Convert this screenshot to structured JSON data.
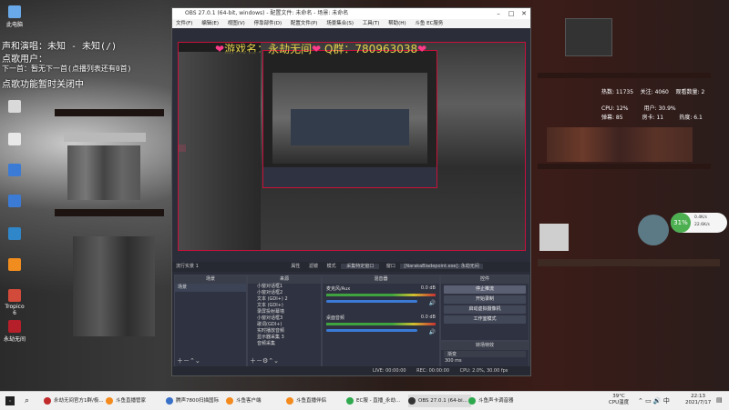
{
  "desktop": {
    "overlay_lines": [
      "声和演唱：未知 - 未知(/)",
      "点歌用户：",
      "下一首：暂无下一首(点播列表还有0首)",
      "点歌功能暂时关闭中"
    ],
    "icons": [
      {
        "label": "此电脑",
        "color": "#6aa9e9"
      },
      {
        "label": "",
        "color": "#d9d9d9"
      },
      {
        "label": "",
        "color": "#3b7bd6"
      },
      {
        "label": "",
        "color": "#e8e8e8"
      },
      {
        "label": "",
        "color": "#3b7bd6"
      },
      {
        "label": "",
        "color": "#3b7bd6"
      },
      {
        "label": "",
        "color": "#2f86c8"
      },
      {
        "label": "",
        "color": "#f08d1e"
      },
      {
        "label": "Tropico 6",
        "color": "#d24b3a"
      },
      {
        "label": "永劫无间",
        "color": "#b51f2a"
      }
    ]
  },
  "obs": {
    "title": "OBS 27.0.1 (64-bit, windows) - 配置文件: 未命名 - 场景: 未命名",
    "menu": [
      "文件(F)",
      "编辑(E)",
      "视图(V)",
      "停靠部件(D)",
      "配置文件(P)",
      "场景集合(S)",
      "工具(T)",
      "帮助(H)",
      "斗鱼 EC服务"
    ],
    "banner": {
      "game": "游戏名：永劫无间",
      "qq": "Q群：780963038"
    },
    "toolbar": {
      "source_label": "流行实景 1",
      "properties": "属性",
      "filters": "滤镜",
      "mode_label": "模式",
      "mode_value": "采集特定窗口",
      "window_label": "窗口",
      "window_value": "[NarakaBladepoint.exe]: 永劫无间"
    },
    "scenes": {
      "header": "场景",
      "items": [
        "场景"
      ]
    },
    "sources": {
      "header": "来源",
      "items": [
        "小窗对话框1",
        "小窗对话框2",
        "文本 (GDI+) 2",
        "文本 (GDI+)",
        "录屏投射幕墙",
        "小窗对话框3",
        "歌词(GDI+)",
        "实时播放音频",
        "显示器采集 3",
        "音频采集",
        "显示器采集"
      ]
    },
    "mixer": {
      "header": "混音器",
      "channels": [
        {
          "name": "麦克风/Aux",
          "db": "0.0 dB"
        },
        {
          "name": "桌面音频",
          "db": "0.0 dB"
        }
      ]
    },
    "transitions": {
      "header": "转场特效",
      "type": "渐变",
      "duration": "300 ms"
    },
    "controls": {
      "header": "控件",
      "buttons": [
        "停止推流",
        "开始录制",
        "启动虚拟摄像机",
        "工作室模式",
        "设置",
        "退出"
      ]
    },
    "status": {
      "live": "LIVE: 00:00:00",
      "rec": "REC: 00:00:00",
      "cpu": "CPU: 2.0%, 30.00 fps"
    }
  },
  "perf_overlay": {
    "lines": [
      {
        "a": "热数: 11735",
        "b": "关注: 4060",
        "c": "观看数量: 2"
      },
      {
        "a": "",
        "b": "",
        "c": ""
      },
      {
        "a": "CPU: 12%",
        "b": "用户: 30.9%",
        "c": ""
      },
      {
        "a": "弹幕: 85",
        "b": "房卡: 11",
        "c": "热度: 6.1"
      }
    ],
    "widget": {
      "percent": "31%",
      "up": "0.4K/s",
      "down": "22.6K/s"
    }
  },
  "taskbar": {
    "items": [
      {
        "label": "永劫无间官方1群/极...",
        "color": "#c12b2b"
      },
      {
        "label": "斗鱼直播管家",
        "color": "#f38a1d"
      },
      {
        "label": "腾声7800扫描国际",
        "color": "#3970c8"
      },
      {
        "label": "斗鱼客户端",
        "color": "#f38a1d"
      },
      {
        "label": "斗鱼直播伴侣",
        "color": "#f38a1d"
      },
      {
        "label": "EC服 - 直播_永劫...",
        "color": "#2fa84e"
      },
      {
        "label": "OBS 27.0.1 (64-bi...",
        "color": "#333"
      },
      {
        "label": "斗鱼声卡调音器",
        "color": "#2fa84e"
      }
    ],
    "weather": {
      "temp": "39°C",
      "label": "CPU温度"
    },
    "clock": {
      "time": "22:13",
      "date": "2021/7/17"
    }
  },
  "colors": {
    "accent_red": "#c8103b",
    "banner_yellow": "#e6d24b",
    "heart_pink": "#ff3b8a"
  }
}
